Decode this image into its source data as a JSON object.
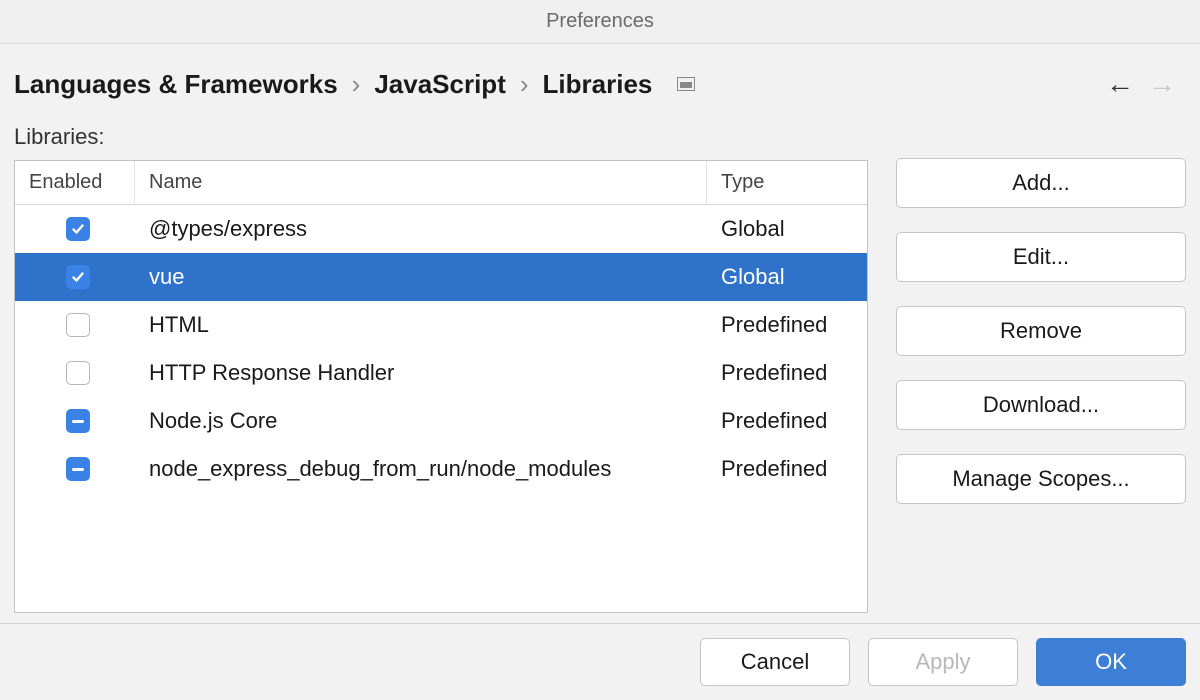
{
  "window_title": "Preferences",
  "breadcrumb": [
    "Languages & Frameworks",
    "JavaScript",
    "Libraries"
  ],
  "nav": {
    "back_enabled": true,
    "forward_enabled": false
  },
  "section_label": "Libraries:",
  "table": {
    "headers": {
      "enabled": "Enabled",
      "name": "Name",
      "type": "Type"
    },
    "rows": [
      {
        "state": "checked",
        "name": "@types/express",
        "type": "Global",
        "selected": false
      },
      {
        "state": "checked",
        "name": "vue",
        "type": "Global",
        "selected": true
      },
      {
        "state": "unchecked",
        "name": "HTML",
        "type": "Predefined",
        "selected": false
      },
      {
        "state": "unchecked",
        "name": "HTTP Response Handler",
        "type": "Predefined",
        "selected": false
      },
      {
        "state": "mixed",
        "name": "Node.js Core",
        "type": "Predefined",
        "selected": false
      },
      {
        "state": "mixed",
        "name": "node_express_debug_from_run/node_modules",
        "type": "Predefined",
        "selected": false
      }
    ]
  },
  "sidebar_buttons": {
    "add": "Add...",
    "edit": "Edit...",
    "remove": "Remove",
    "download": "Download...",
    "manage_scopes": "Manage Scopes..."
  },
  "footer": {
    "cancel": "Cancel",
    "apply": "Apply",
    "ok": "OK",
    "apply_enabled": false
  }
}
